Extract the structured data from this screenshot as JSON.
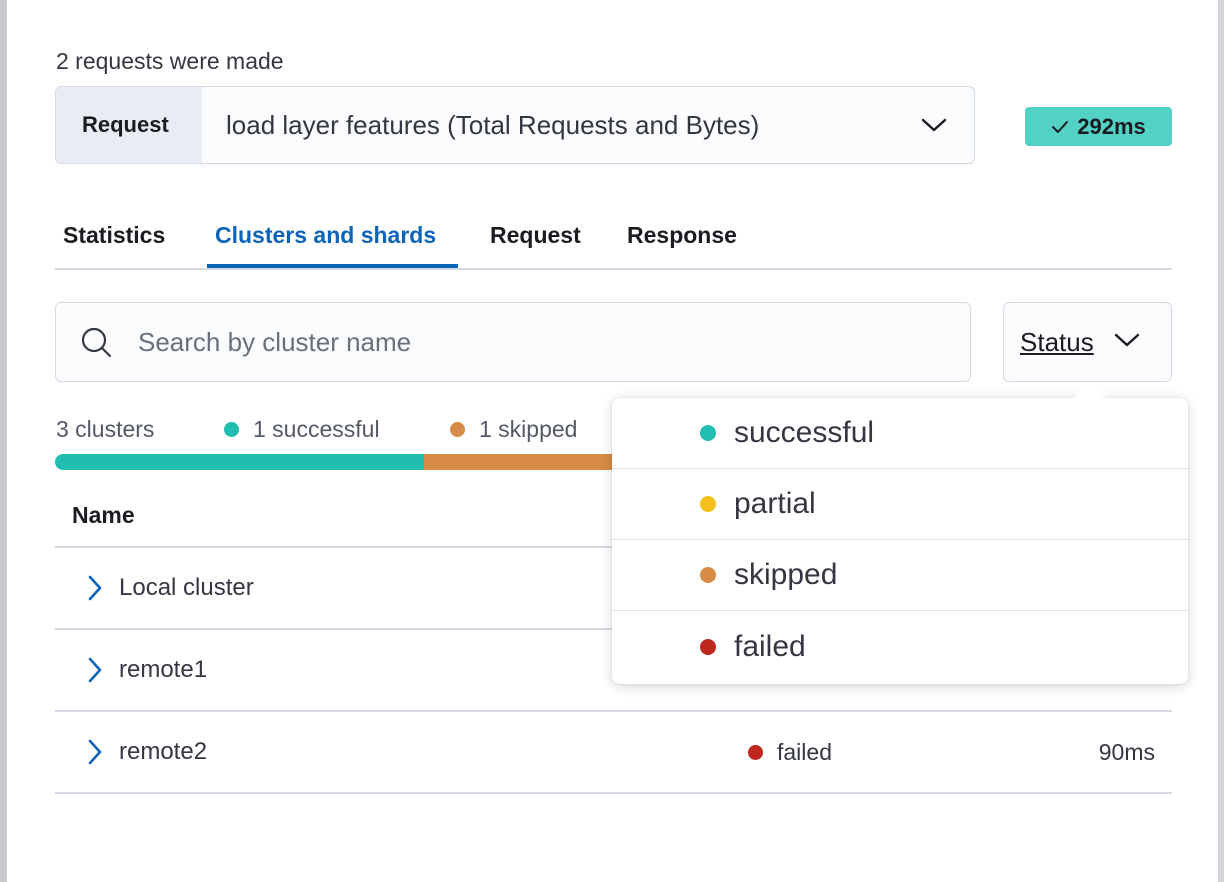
{
  "header": {
    "requests_made": "2 requests were made",
    "request_select": {
      "prepend_label": "Request",
      "selected_value": "load layer features (Total Requests and Bytes)",
      "icon": "chevron-down-icon"
    },
    "timing_badge": {
      "icon": "check-icon",
      "label": "292ms",
      "color": "#54d1c5"
    }
  },
  "tabs": [
    {
      "label": "Statistics",
      "active": false
    },
    {
      "label": "Clusters and shards",
      "active": true
    },
    {
      "label": "Request",
      "active": false
    },
    {
      "label": "Response",
      "active": false
    }
  ],
  "search": {
    "placeholder": "Search by cluster name",
    "value": "",
    "icon": "search-icon"
  },
  "status_filter": {
    "label": "Status",
    "icon": "chevron-down-icon"
  },
  "summary": {
    "total": "3 clusters",
    "successful": {
      "label": "1 successful",
      "color": "#1fbeb1",
      "count": 1
    },
    "skipped": {
      "label": "1 skipped",
      "color": "#d88b46",
      "count": 1
    }
  },
  "table": {
    "columns": {
      "name": "Name"
    },
    "rows": [
      {
        "name": "Local cluster",
        "status": "",
        "time": ""
      },
      {
        "name": "remote1",
        "status": "",
        "time": ""
      },
      {
        "name": "remote2",
        "status": "failed",
        "status_color": "#bd271e",
        "time": "90ms"
      }
    ]
  },
  "status_popover": {
    "options": [
      {
        "label": "successful",
        "color": "#1fbeb1"
      },
      {
        "label": "partial",
        "color": "#f5c11c"
      },
      {
        "label": "skipped",
        "color": "#d88b46"
      },
      {
        "label": "failed",
        "color": "#bd271e"
      }
    ]
  }
}
